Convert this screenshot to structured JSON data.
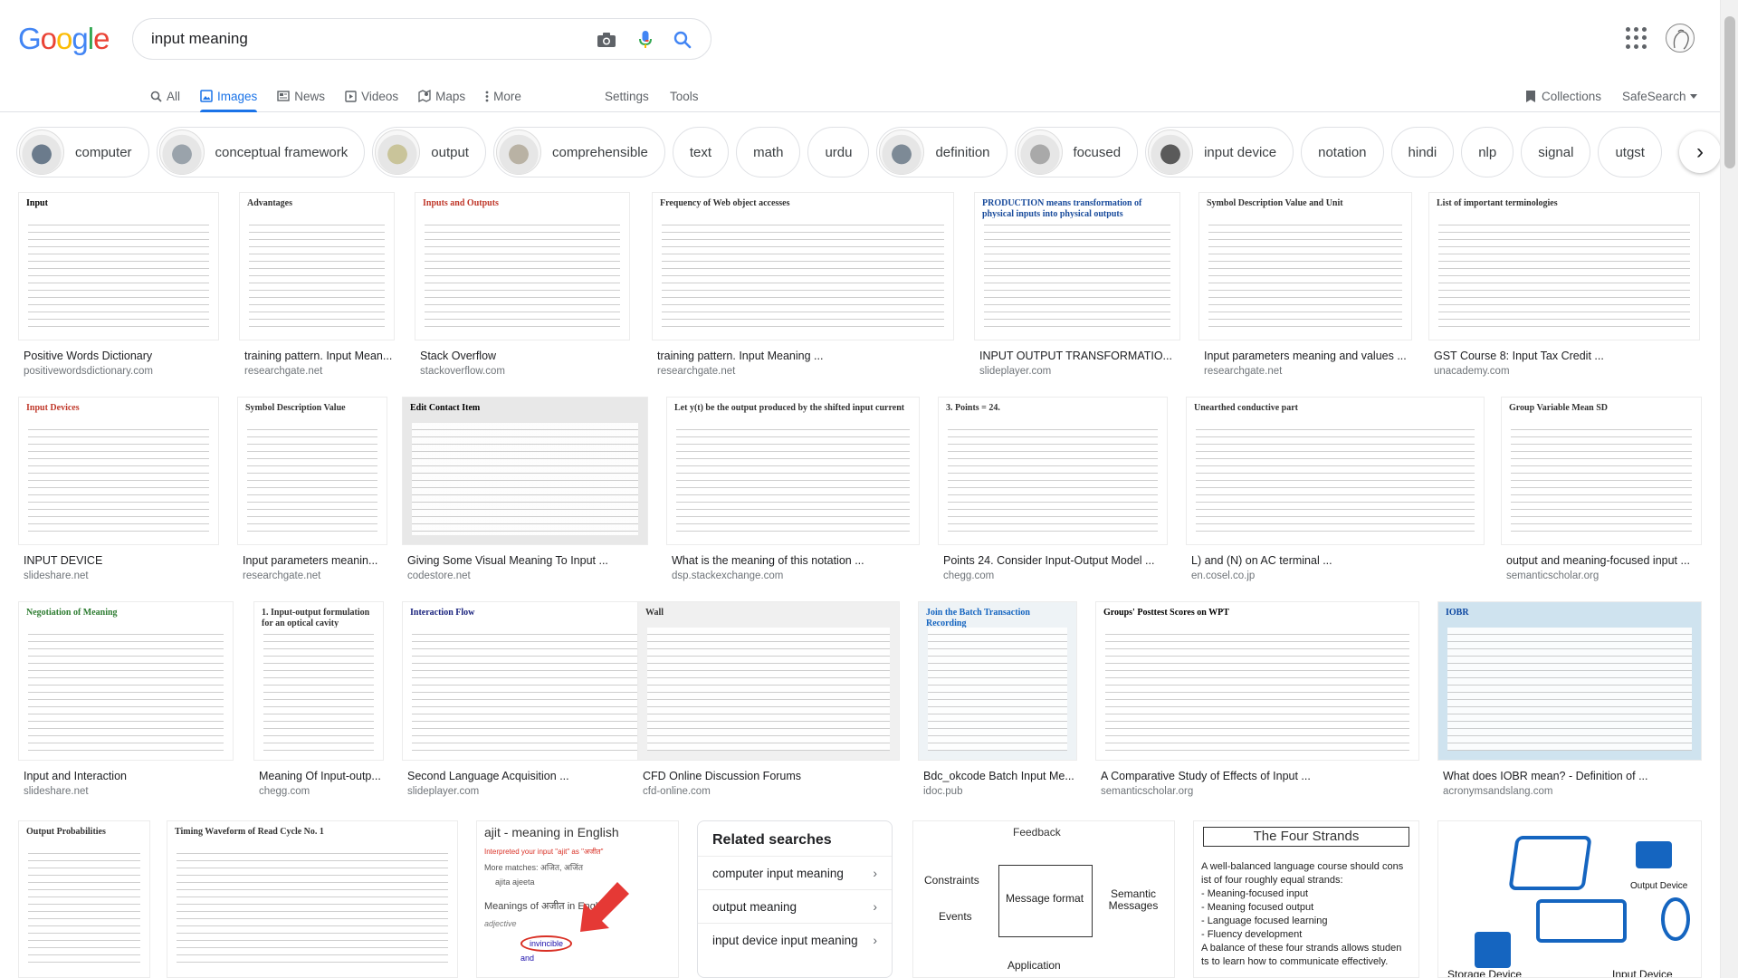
{
  "header": {
    "logo_letters": [
      {
        "ch": "G",
        "color": "#4285f4"
      },
      {
        "ch": "o",
        "color": "#ea4335"
      },
      {
        "ch": "o",
        "color": "#fbbc05"
      },
      {
        "ch": "g",
        "color": "#4285f4"
      },
      {
        "ch": "l",
        "color": "#34a853"
      },
      {
        "ch": "e",
        "color": "#ea4335"
      }
    ],
    "search_value": "input meaning",
    "icons": [
      "camera-icon",
      "microphone-icon",
      "search-icon",
      "apps-icon",
      "avatar"
    ]
  },
  "tabs": [
    {
      "label": "All",
      "icon": "search-icon",
      "active": false
    },
    {
      "label": "Images",
      "icon": "image-icon",
      "active": true
    },
    {
      "label": "News",
      "icon": "news-icon",
      "active": false
    },
    {
      "label": "Videos",
      "icon": "video-icon",
      "active": false
    },
    {
      "label": "Maps",
      "icon": "map-icon",
      "active": false
    },
    {
      "label": "More",
      "icon": "more-icon",
      "active": false
    }
  ],
  "settings_label": "Settings",
  "tools_label": "Tools",
  "collections_label": "Collections",
  "safesearch_label": "SafeSearch",
  "chips": [
    {
      "label": "computer",
      "thumb": true
    },
    {
      "label": "conceptual framework",
      "thumb": true
    },
    {
      "label": "output",
      "thumb": true
    },
    {
      "label": "comprehensible",
      "thumb": true
    },
    {
      "label": "text",
      "thumb": false
    },
    {
      "label": "math",
      "thumb": false
    },
    {
      "label": "urdu",
      "thumb": false
    },
    {
      "label": "definition",
      "thumb": true
    },
    {
      "label": "focused",
      "thumb": true
    },
    {
      "label": "input device",
      "thumb": true
    },
    {
      "label": "notation",
      "thumb": false
    },
    {
      "label": "hindi",
      "thumb": false
    },
    {
      "label": "nlp",
      "thumb": false
    },
    {
      "label": "signal",
      "thumb": false
    },
    {
      "label": "utgst",
      "thumb": false
    }
  ],
  "results": [
    {
      "row": 0,
      "title": "Positive Words Dictionary",
      "source": "positivewordsdictionary.com",
      "thumb_text": "Input"
    },
    {
      "row": 0,
      "title": "training pattern. Input Mean...",
      "source": "researchgate.net",
      "thumb_text": "Advantages"
    },
    {
      "row": 0,
      "title": "Stack Overflow",
      "source": "stackoverflow.com",
      "thumb_text": "Inputs and Outputs"
    },
    {
      "row": 0,
      "title": "training pattern. Input Meaning ...",
      "source": "researchgate.net",
      "thumb_text": "Frequency of Web object accesses"
    },
    {
      "row": 0,
      "title": "INPUT OUTPUT TRANSFORMATIO...",
      "source": "slideplayer.com",
      "thumb_text": "PRODUCTION means transformation of physical inputs into physical outputs"
    },
    {
      "row": 0,
      "title": "Input parameters meaning and values ...",
      "source": "researchgate.net",
      "thumb_text": "Symbol  Description  Value and Unit"
    },
    {
      "row": 0,
      "title": "GST Course 8: Input Tax Credit ...",
      "source": "unacademy.com",
      "thumb_text": "List of important terminologies"
    },
    {
      "row": 1,
      "title": "INPUT DEVICE",
      "source": "slideshare.net",
      "thumb_text": "Input Devices"
    },
    {
      "row": 1,
      "title": "Input parameters meanin...",
      "source": "researchgate.net",
      "thumb_text": "Symbol  Description  Value"
    },
    {
      "row": 1,
      "title": "Giving Some Visual Meaning To Input ...",
      "source": "codestore.net",
      "thumb_text": "Edit Contact Item"
    },
    {
      "row": 1,
      "title": "What is the meaning of this notation ...",
      "source": "dsp.stackexchange.com",
      "thumb_text": "Let y(t) be the output produced by the shifted input current"
    },
    {
      "row": 1,
      "title": "Points 24. Consider Input-Output Model ...",
      "source": "chegg.com",
      "thumb_text": "3. Points = 24."
    },
    {
      "row": 1,
      "title": "L) and (N) on AC terminal ...",
      "source": "en.cosel.co.jp",
      "thumb_text": "Unearthed conductive part"
    },
    {
      "row": 1,
      "title": "output and meaning-focused input ...",
      "source": "semanticscholar.org",
      "thumb_text": "Group  Variable  Mean  SD"
    },
    {
      "row": 2,
      "title": "Input and Interaction",
      "source": "slideshare.net",
      "thumb_text": "Negotiation of Meaning"
    },
    {
      "row": 2,
      "title": "Meaning Of Input-outp...",
      "source": "chegg.com",
      "thumb_text": "1. Input-output formulation for an optical cavity"
    },
    {
      "row": 2,
      "title": "Second Language Acquisition ...",
      "source": "slideplayer.com",
      "thumb_text": "Interaction Flow"
    },
    {
      "row": 2,
      "title": "CFD Online Discussion Forums",
      "source": "cfd-online.com",
      "thumb_text": "Wall"
    },
    {
      "row": 2,
      "title": "Bdc_okcode Batch Input Me...",
      "source": "idoc.pub",
      "thumb_text": "Join the Batch Transaction Recording"
    },
    {
      "row": 2,
      "title": "A Comparative Study of Effects of Input ...",
      "source": "semanticscholar.org",
      "thumb_text": "Groups' Posttest Scores on WPT"
    },
    {
      "row": 2,
      "title": "What does IOBR mean? - Definition of ...",
      "source": "acronymsandslang.com",
      "thumb_text": "IOBR"
    }
  ],
  "row3_thumbs": [
    {
      "thumb_text": "Output Probabilities"
    },
    {
      "thumb_text": "Timing Waveform of Read Cycle No. 1"
    },
    {
      "thumb_text": "ajit - meaning in English"
    },
    {
      "thumb_text": "Feedback"
    },
    {
      "thumb_text": "The Four Strands"
    },
    {
      "thumb_text": "Output Device"
    }
  ],
  "row3_detail": {
    "ajit_sub": "Interpreted your input \"ajit\" as \"अजीत\"",
    "ajit_more": "More matches: अजित, अजिंत",
    "ajit_pron": "ajita  ajeeta",
    "ajit_meanings": "Meanings of अजीत in English",
    "ajit_pos": "adjective",
    "ajit_word1": "invincible",
    "ajit_word2": "and",
    "feedback_constraints": "Constraints",
    "feedback_events": "Events",
    "feedback_message": "Message format",
    "feedback_semantic": "Semantic Messages",
    "feedback_application": "Application",
    "strands_lines": [
      "A well-balanced language course should cons",
      "ist of four roughly equal strands:",
      "- Meaning-focused input",
      "- Meaning focused output",
      "- Language focused learning",
      "- Fluency development",
      "A balance of these four strands allows studen",
      "ts to learn how to communicate effectively."
    ],
    "device_output": "Output Device",
    "device_storage": "Storage Device",
    "device_input": "Input Device"
  },
  "related": {
    "heading": "Related searches",
    "items": [
      "computer input meaning",
      "output meaning",
      "input device input meaning"
    ]
  },
  "colors": {
    "accent": "#1a73e8",
    "link_gray": "#70757a",
    "border": "#dfe1e5"
  }
}
